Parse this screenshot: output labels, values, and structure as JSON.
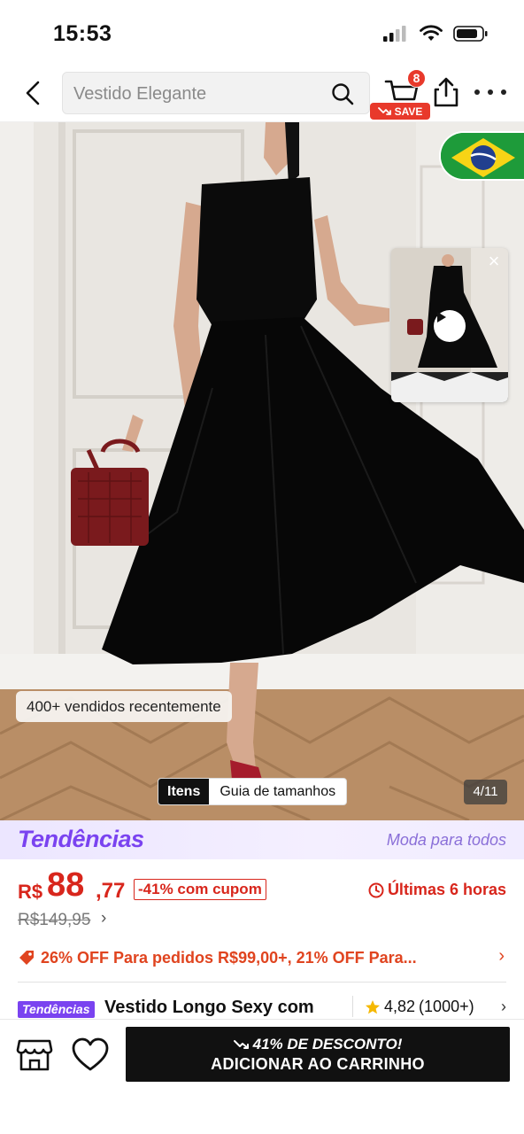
{
  "status_bar": {
    "time": "15:53"
  },
  "header": {
    "search_placeholder": "Vestido Elegante",
    "cart_count": "8",
    "save_label": "SAVE"
  },
  "gallery": {
    "sold_label": "400+ vendidos recentemente",
    "tab_items": "Itens",
    "tab_size_guide": "Guia de tamanhos",
    "page_counter": "4/11",
    "flag_country": "brazil-flag-icon"
  },
  "trends": {
    "logo": "Tendências",
    "tagline": "Moda para todos"
  },
  "price": {
    "currency": "R$",
    "integer": "88",
    "decimal": ",77",
    "coupon": "-41% com cupom",
    "timer": "Últimas 6 horas",
    "old_price": "R$149,95",
    "old_price_chevron": "›"
  },
  "promo": {
    "text": "26% OFF Para pedidos R$99,00+,  21% OFF Para...",
    "chevron": "›"
  },
  "product": {
    "badge": "Tendências",
    "title": "Vestido Longo Sexy com",
    "rating": "4,82",
    "reviews": "(1000+)",
    "chevron": "›"
  },
  "bottom_bar": {
    "discount_label": "41% DE DESCONTO!",
    "cta_label": "ADICIONAR AO CARRINHO"
  },
  "colors": {
    "accent_red": "#d8261c",
    "trend_purple": "#7a43f0",
    "cta_black": "#111111"
  }
}
